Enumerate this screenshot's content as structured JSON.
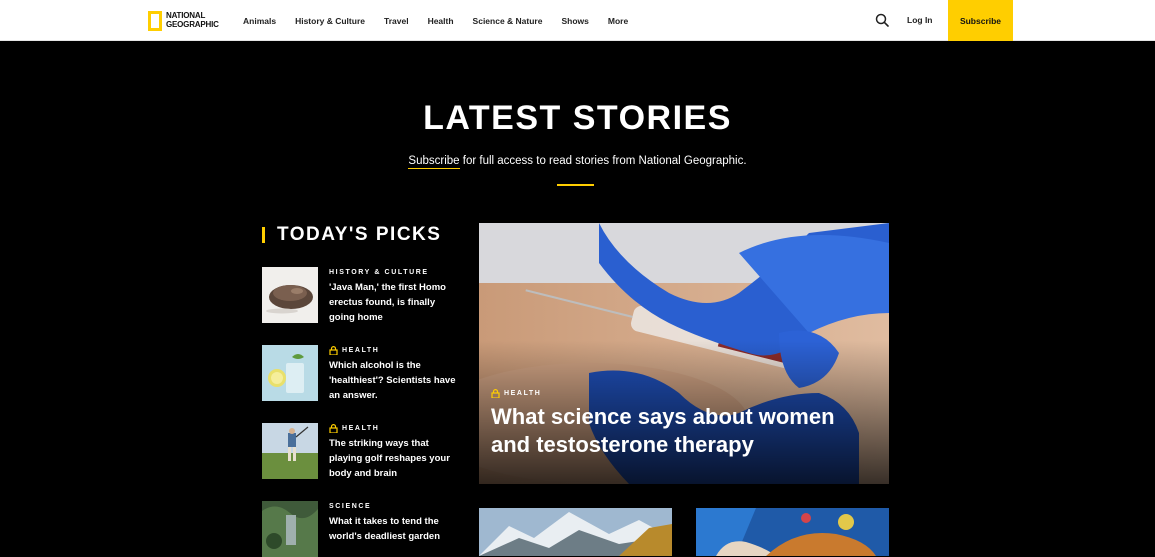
{
  "nav": {
    "logo_line1": "NATIONAL",
    "logo_line2": "GEOGRAPHIC",
    "items": [
      "Animals",
      "History & Culture",
      "Travel",
      "Health",
      "Science & Nature",
      "Shows",
      "More"
    ],
    "login": "Log In",
    "subscribe": "Subscribe",
    "search_icon": "search-icon",
    "accent_color": "#ffce00"
  },
  "hero": {
    "title": "LATEST STORIES",
    "subscribe_link": "Subscribe",
    "subtitle_rest": " for full access to read stories from National Geographic."
  },
  "picks": {
    "heading": "TODAY'S PICKS",
    "items": [
      {
        "category": "HISTORY & CULTURE",
        "locked": false,
        "title": "'Java Man,' the first Homo erectus found, is finally going home"
      },
      {
        "category": "HEALTH",
        "locked": true,
        "title": "Which alcohol is the 'healthiest'? Scientists have an answer."
      },
      {
        "category": "HEALTH",
        "locked": true,
        "title": "The striking ways that playing golf reshapes your body and brain"
      },
      {
        "category": "SCIENCE",
        "locked": false,
        "title": "What it takes to tend the world's deadliest garden"
      }
    ]
  },
  "feature": {
    "category": "HEALTH",
    "locked": true,
    "title": "What science says about women and testosterone therapy"
  }
}
